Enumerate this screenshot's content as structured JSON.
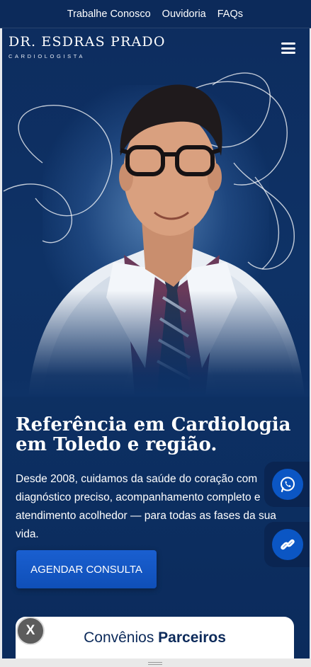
{
  "topbar": {
    "links": [
      "Trabalhe Conosco",
      "Ouvidoria",
      "FAQs"
    ]
  },
  "header": {
    "brand_name": "DR. ESDRAS PRADO",
    "brand_subtitle": "CARDIOLOGISTA",
    "menu_icon": "hamburger-menu-icon"
  },
  "hero": {
    "headline": "Referência em Cardiologia em Toledo e região.",
    "description": "Desde 2008, cuidamos da saúde do coração com diagnóstico preciso, acompanhamento completo e atendimento acolhedor — para todas as fases da sua vida.",
    "cta_label": "AGENDAR CONSULTA"
  },
  "floating": {
    "whatsapp_icon": "whatsapp-icon",
    "link_icon": "link-icon"
  },
  "card": {
    "title_regular": "Convênios",
    "title_bold": "Parceiros"
  },
  "close_button": {
    "label": "X"
  },
  "colors": {
    "navy": "#0c2a5a",
    "accent_blue": "#0f4fb8",
    "white": "#ffffff"
  }
}
